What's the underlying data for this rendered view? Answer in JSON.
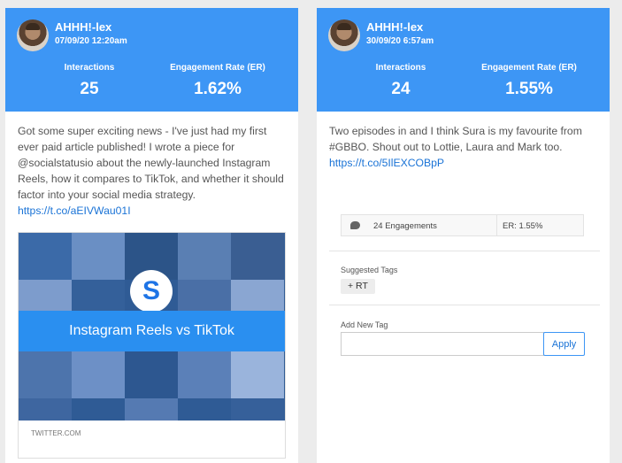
{
  "posts": [
    {
      "username": "AHHH!-lex",
      "date": "07/09/20 12:20am",
      "interactions_label": "Interactions",
      "interactions": "25",
      "er_label": "Engagement Rate (ER)",
      "er": "1.62%",
      "text": "Got some super exciting news - I've just had my first ever paid article published! I wrote a piece for @socialstatusio about the newly-launched Instagram Reels, how it compares to TikTok, and whether it should factor into your social media strategy.",
      "link": "https://t.co/aEIVWau01I",
      "preview": {
        "banner": "Instagram Reels vs TikTok",
        "logo": "S",
        "domain": "TWITTER.COM"
      }
    },
    {
      "username": "AHHH!-lex",
      "date": "30/09/20 6:57am",
      "interactions_label": "Interactions",
      "interactions": "24",
      "er_label": "Engagement Rate (ER)",
      "er": "1.55%",
      "text": "Two episodes in and I think Sura is my favourite from #GBBO. Shout out to Lottie, Laura and Mark too.",
      "link": "https://t.co/5IlEXCOBpP",
      "stats": {
        "engagements": "24 Engagements",
        "er": "ER: 1.55%"
      },
      "suggested_tags_label": "Suggested Tags",
      "suggested_tag": "+ RT",
      "add_tag_label": "Add New Tag",
      "add_tag_value": "",
      "apply_label": "Apply"
    }
  ],
  "colors": {
    "header": "#3d96f5",
    "link": "#1a73d6",
    "background": "#ececec"
  },
  "icons": [
    "avatar-photo",
    "comment-icon",
    "brand-logo"
  ]
}
